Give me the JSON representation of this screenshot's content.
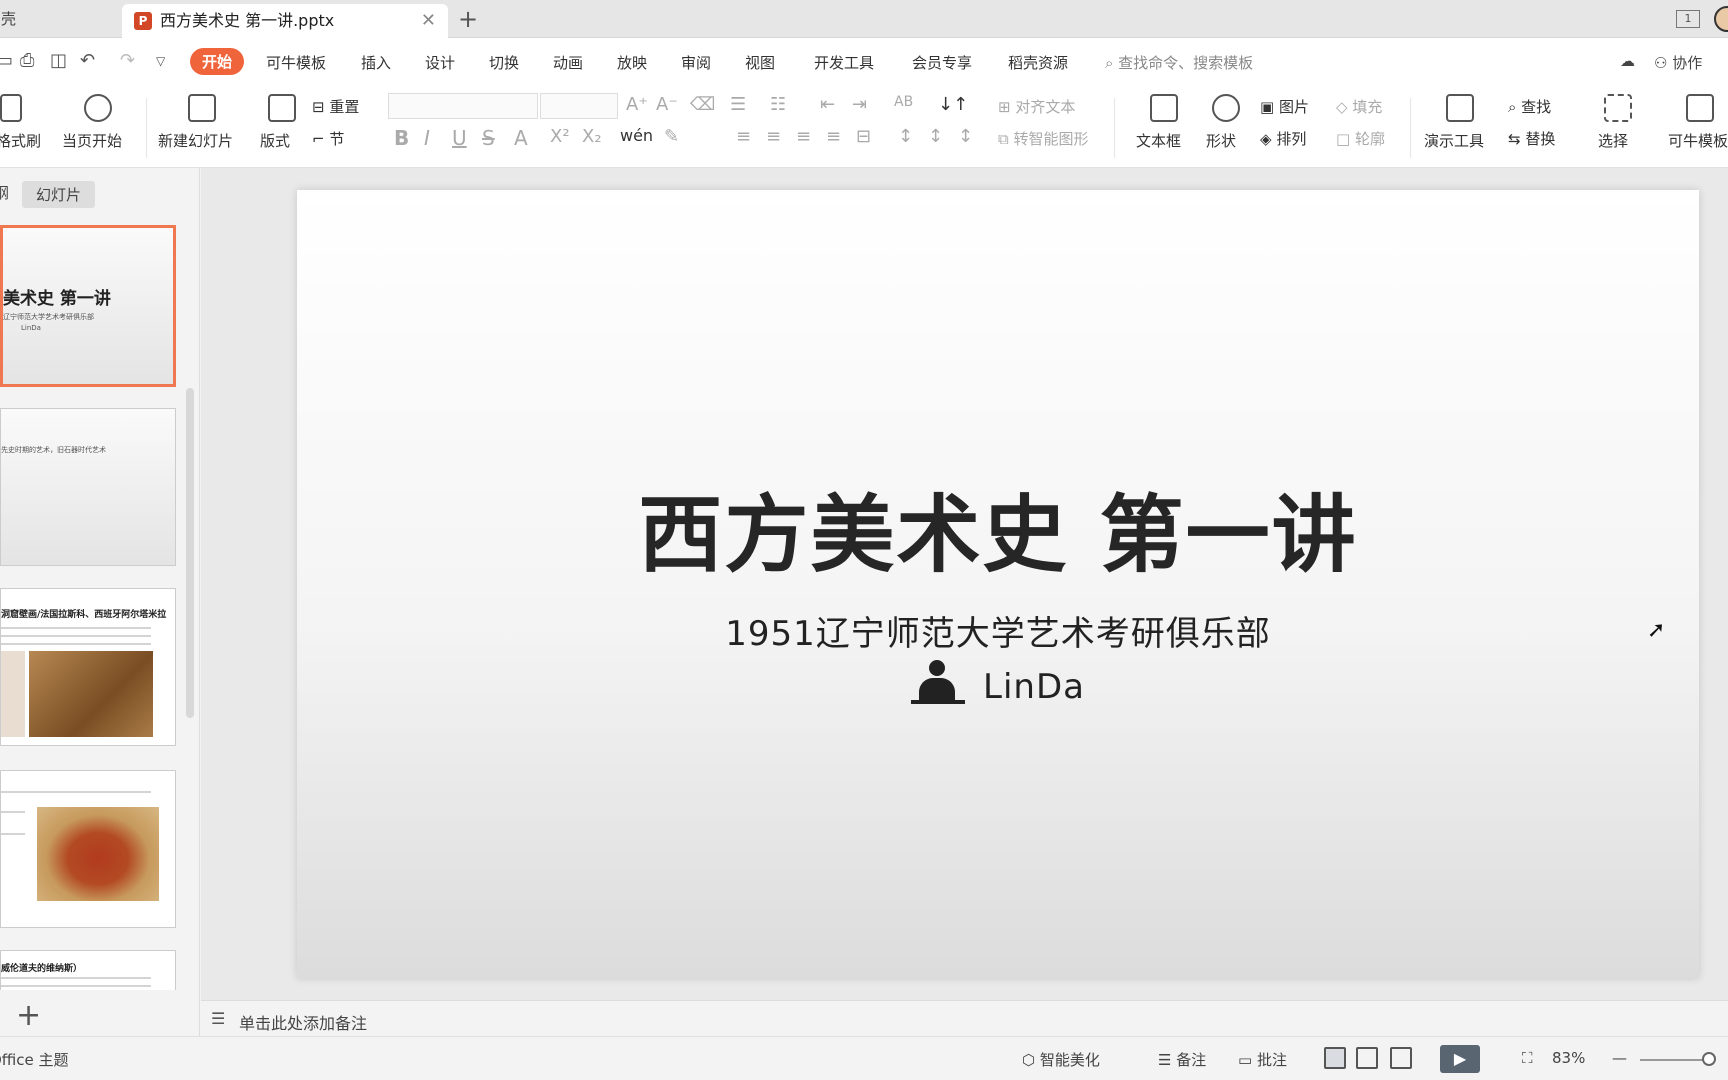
{
  "tabs": {
    "home_label": "稻壳",
    "doc_icon": "P",
    "doc_title": "西方美术史 第一讲.pptx",
    "close_glyph": "✕",
    "add_glyph": "+",
    "window_badge": "1"
  },
  "menu": {
    "items": [
      "开始",
      "可牛模板",
      "插入",
      "设计",
      "切换",
      "动画",
      "放映",
      "审阅",
      "视图",
      "开发工具",
      "会员专享",
      "稻壳资源"
    ],
    "search_placeholder": "查找命令、搜索模板",
    "collaborate": "协作"
  },
  "ribbon": {
    "format_painter": "格式刷",
    "play_current": "当页开始",
    "new_slide": "新建幻灯片",
    "layout": "版式",
    "reset": "重置",
    "section": "节",
    "align_text": "对齐文本",
    "smartart": "转智能图形",
    "textbox": "文本框",
    "shape": "形状",
    "picture": "图片",
    "arrange": "排列",
    "fill": "填充",
    "outline": "轮廓",
    "present_tools": "演示工具",
    "find": "查找",
    "replace": "替换",
    "select": "选择",
    "templates": "可牛模板"
  },
  "panel": {
    "tab_outline": "纲",
    "tab_slides": "幻灯片",
    "thumb1_title": "美术史 第一讲",
    "thumb1_sub": "辽宁师范大学艺术考研俱乐部",
    "thumb1_author": "LinDa",
    "thumb2_text": "先史时期的艺术，旧石器时代艺术",
    "thumb3_head": "洞窟壁画/法国拉斯科、西班牙阿尔塔米拉",
    "thumb5_head": "威伦道夫的维纳斯）",
    "add_glyph": "+"
  },
  "slide": {
    "title": "西方美术史 第一讲",
    "subtitle": "1951辽宁师范大学艺术考研俱乐部",
    "author": "LinDa"
  },
  "notes": {
    "placeholder": "单击此处添加备注"
  },
  "status": {
    "theme": "Office 主题",
    "beautify": "智能美化",
    "notes": "备注",
    "comments": "批注",
    "zoom": "83%"
  }
}
